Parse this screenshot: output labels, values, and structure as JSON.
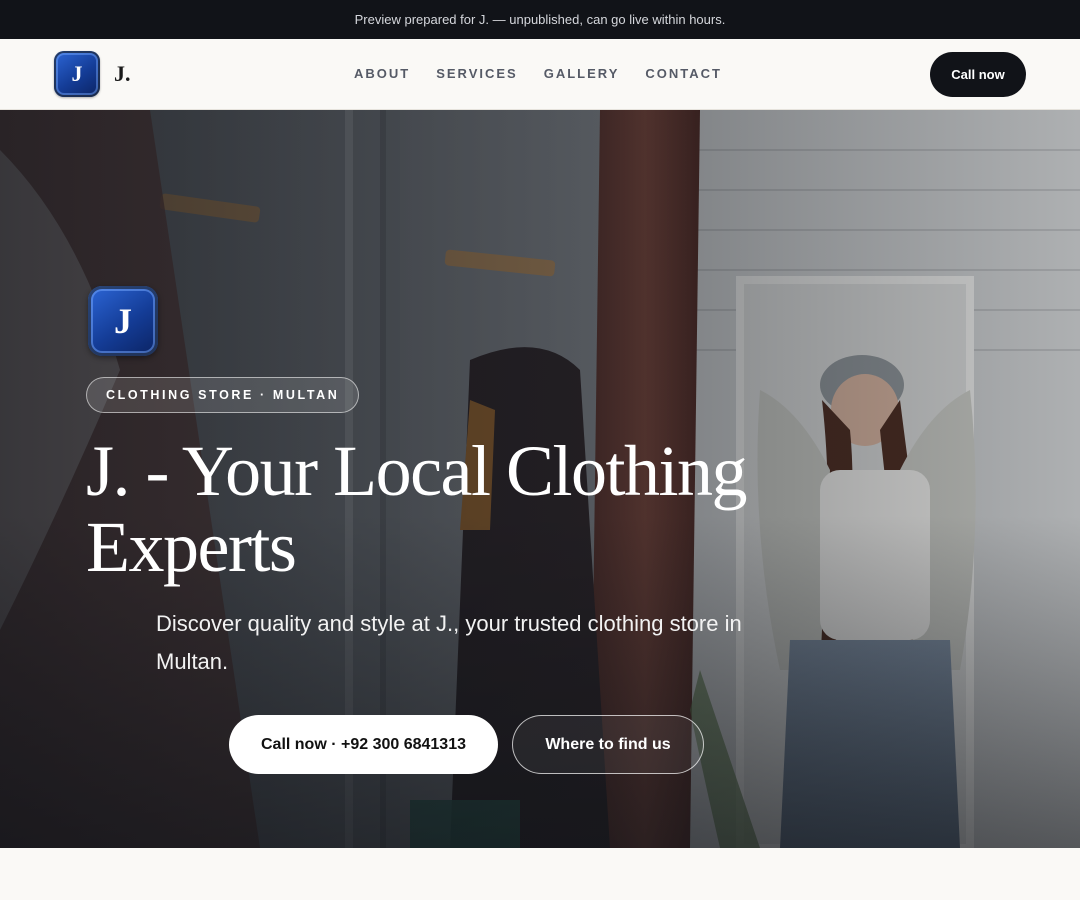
{
  "preview_bar": {
    "text": "Preview prepared for J. — unpublished, can go live within hours."
  },
  "nav": {
    "logo_letter": "J",
    "brand": "J.",
    "links": [
      {
        "label": "ABOUT"
      },
      {
        "label": "SERVICES"
      },
      {
        "label": "GALLERY"
      },
      {
        "label": "CONTACT"
      }
    ],
    "cta_label": "Call now"
  },
  "hero": {
    "logo_letter": "J",
    "badge": "CLOTHING STORE · MULTAN",
    "title_line1": "J. - Your Local Clothing",
    "title_line2": "Experts",
    "subtitle": "Discover quality and style at J., your trusted clothing store in Multan.",
    "primary_cta": "Call now · +92 300 6841313",
    "secondary_cta": "Where to find us"
  },
  "colors": {
    "dark": "#111318",
    "page_bg": "#faf9f6",
    "logo_blue": "#143c96",
    "white": "#ffffff"
  }
}
